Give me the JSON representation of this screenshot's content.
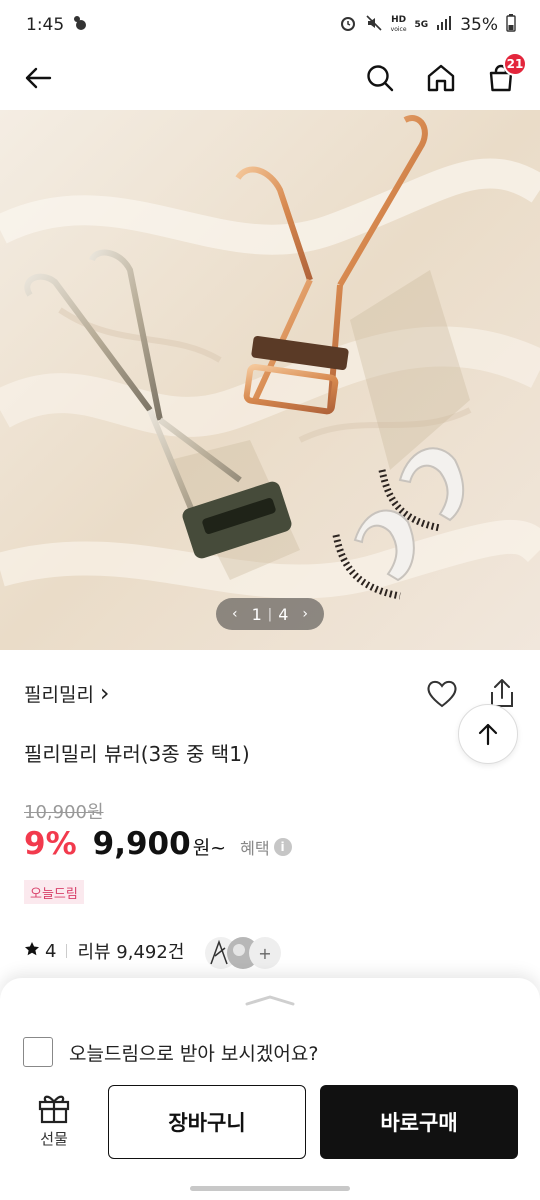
{
  "status_bar": {
    "time": "1:45",
    "battery": "35%",
    "network": "5G",
    "hd_label": "HD",
    "voice_label": "voice"
  },
  "nav": {
    "cart_count": "21"
  },
  "gallery": {
    "current": "1",
    "separator": "|",
    "total": "4",
    "prev": "‹",
    "next": "›"
  },
  "product": {
    "brand": "필리밀리",
    "brand_chevron": "›",
    "title": "필리밀리 뷰러(3종 중 택1)",
    "original_price": "10,900원",
    "discount": "9%",
    "price": "9,900",
    "price_unit": "원~",
    "benefit_label": "혜택",
    "info_icon": "i",
    "delivery_tag": "오늘드림",
    "rating": "4",
    "review_label": "리뷰 9,492건",
    "more_avatars": "+"
  },
  "bottom_sheet": {
    "checkbox_label": "오늘드림으로 받아 보시겠어요?",
    "gift_label": "선물",
    "cart_button": "장바구니",
    "buy_button": "바로구매"
  },
  "colors": {
    "accent_red": "#f23a4d",
    "badge_red": "#e3263c",
    "tag_bg": "#fbe9ee",
    "tag_text": "#d8416a"
  }
}
